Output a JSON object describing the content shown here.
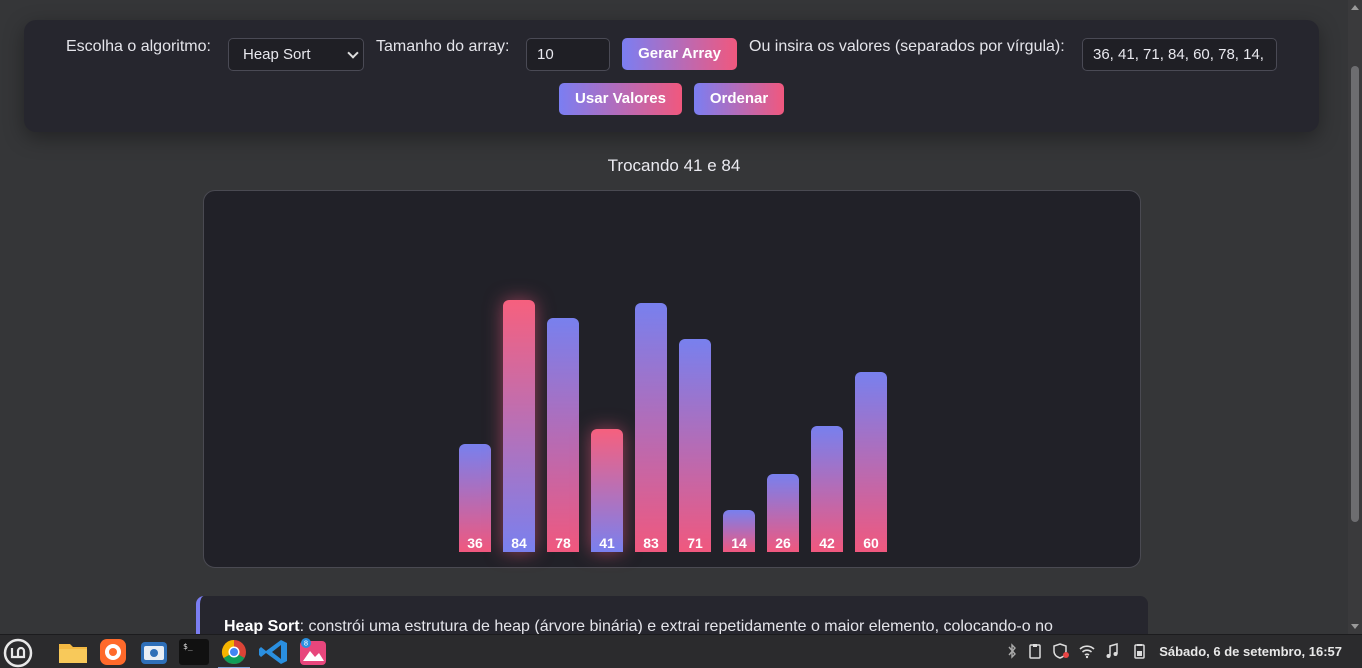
{
  "controls": {
    "algorithm_label": "Escolha o algoritmo:",
    "algorithm_selected": "Heap Sort",
    "size_label": "Tamanho do array:",
    "size_value": "10",
    "generate_button": "Gerar Array",
    "values_label": "Ou insira os valores (separados por vírgula):",
    "values_input": "36, 41, 71, 84, 60, 78, 14,",
    "use_values_button": "Usar Valores",
    "sort_button": "Ordenar"
  },
  "status_text": "Trocando 41 e 84",
  "bars": [
    {
      "value": 36,
      "label": "36",
      "highlight": false
    },
    {
      "value": 84,
      "label": "84",
      "highlight": true
    },
    {
      "value": 78,
      "label": "78",
      "highlight": false
    },
    {
      "value": 41,
      "label": "41",
      "highlight": true
    },
    {
      "value": 83,
      "label": "83",
      "highlight": false
    },
    {
      "value": 71,
      "label": "71",
      "highlight": false
    },
    {
      "value": 14,
      "label": "14",
      "highlight": false
    },
    {
      "value": 26,
      "label": "26",
      "highlight": false
    },
    {
      "value": 42,
      "label": "42",
      "highlight": false
    },
    {
      "value": 60,
      "label": "60",
      "highlight": false
    }
  ],
  "description": {
    "title": "Heap Sort",
    "text": ": constrói uma estrutura de heap (árvore binária) e extrai repetidamente o maior elemento, colocando-o no"
  },
  "colors": {
    "gradient_start": "#7b7ef2",
    "gradient_end": "#f0587e",
    "panel_bg": "#26262e",
    "page_bg": "#353638"
  },
  "taskbar": {
    "apps": [
      "mint-menu-icon",
      "files-icon",
      "firefox-icon",
      "screenshot-icon",
      "terminal-icon",
      "chrome-icon",
      "vscode-icon",
      "image-viewer-icon"
    ],
    "badge": "8",
    "clock": "Sábado, 6 de setembro, 16:57"
  }
}
